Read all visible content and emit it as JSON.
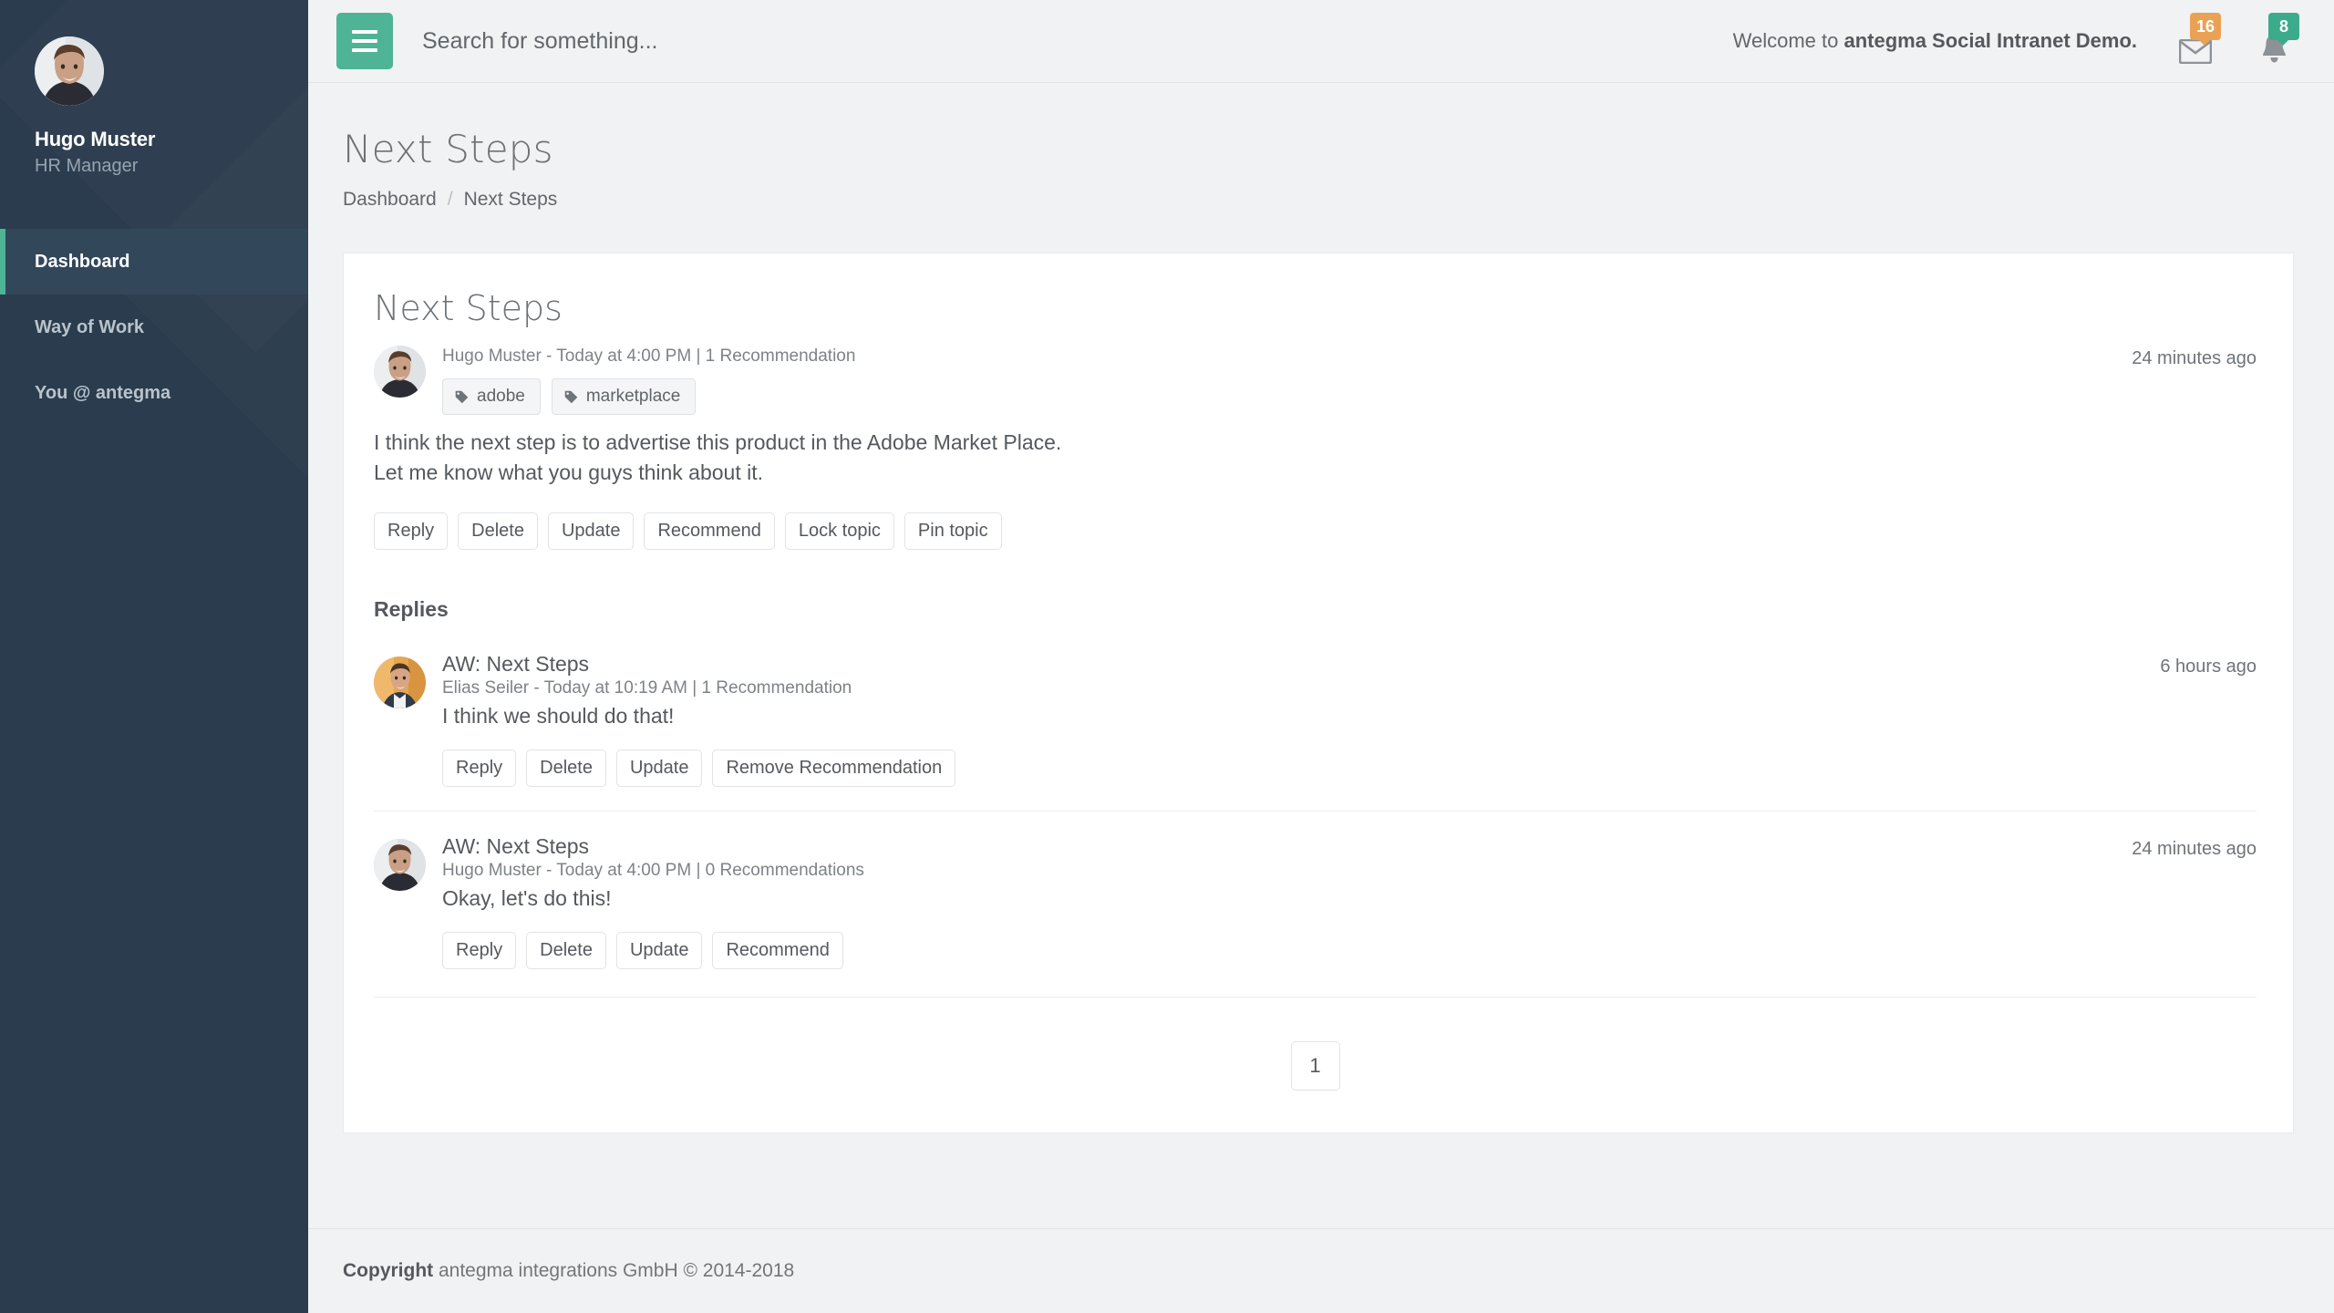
{
  "sidebar": {
    "profile": {
      "name": "Hugo Muster",
      "role": "HR Manager",
      "avatar_icon": "user-avatar-hugo"
    },
    "items": [
      {
        "label": "Dashboard",
        "active": true
      },
      {
        "label": "Way of Work",
        "active": false
      },
      {
        "label": "You @ antegma",
        "active": false
      }
    ]
  },
  "topbar": {
    "menu_icon": "hamburger-icon",
    "search": {
      "placeholder": "Search for something...",
      "value": ""
    },
    "welcome_prefix": "Welcome to ",
    "welcome_brand": "antegma Social Intranet Demo.",
    "messages": {
      "icon": "envelope-icon",
      "count": "16",
      "color": "#e9a254"
    },
    "notifications": {
      "icon": "bell-icon",
      "count": "8",
      "color": "#3cab8b"
    }
  },
  "page": {
    "title": "Next Steps",
    "breadcrumb": [
      {
        "label": "Dashboard",
        "link": true
      },
      {
        "label": "/",
        "link": false
      },
      {
        "label": "Next Steps",
        "link": false
      }
    ]
  },
  "post": {
    "title": "Next Steps",
    "avatar_icon": "user-avatar-hugo",
    "meta": "Hugo Muster - Today at 4:00 PM | 1 Recommendation",
    "timestamp": "24 minutes ago",
    "tags": [
      {
        "label": "adobe",
        "icon": "tag-icon"
      },
      {
        "label": "marketplace",
        "icon": "tag-icon"
      }
    ],
    "text": "I think the next step is to advertise this product in the Adobe Market Place. Let me know what you guys think about it.",
    "buttons": [
      "Reply",
      "Delete",
      "Update",
      "Recommend",
      "Lock topic",
      "Pin topic"
    ]
  },
  "replies": {
    "heading": "Replies",
    "items": [
      {
        "title": "AW: Next Steps",
        "avatar_icon": "user-avatar-elias",
        "meta": "Elias Seiler - Today at 10:19 AM | 1 Recommendation",
        "text": "I think we should do that!",
        "timestamp": "6 hours ago",
        "buttons": [
          "Reply",
          "Delete",
          "Update",
          "Remove Recommendation"
        ]
      },
      {
        "title": "AW: Next Steps",
        "avatar_icon": "user-avatar-hugo",
        "meta": "Hugo Muster - Today at 4:00 PM | 0 Recommendations",
        "text": "Okay, let's do this!",
        "timestamp": "24 minutes ago",
        "buttons": [
          "Reply",
          "Delete",
          "Update",
          "Recommend"
        ]
      }
    ]
  },
  "pagination": {
    "pages": [
      "1"
    ],
    "current": "1"
  },
  "footer": {
    "bold": "Copyright",
    "text": " antegma integrations GmbH © 2014-2018"
  },
  "colors": {
    "accent_green": "#4fb395",
    "sidebar_bg": "#2b3c4e",
    "sidebar_active_bg": "#33475b",
    "page_bg": "#f1f2f3",
    "badge_orange": "#e9a254",
    "badge_green": "#3cab8b"
  }
}
